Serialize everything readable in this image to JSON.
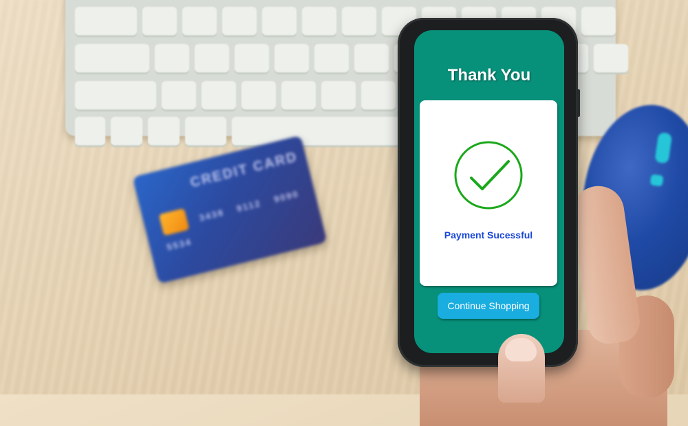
{
  "scene": {
    "background_objects": {
      "keyboard": "white-keyboard",
      "card_label": "CREDIT CARD",
      "card_number_fragments": [
        "5534",
        "3438",
        "9112",
        "9090"
      ],
      "mouse": "blue-mouse"
    }
  },
  "phone_screen": {
    "title": "Thank You",
    "status_icon": "check-circle-icon",
    "status_text": "Payment Sucessful",
    "continue_button_label": "Continue Shopping"
  },
  "colors": {
    "screen_background": "#07917a",
    "panel_background": "#ffffff",
    "check_green": "#1aa81a",
    "status_text_blue": "#1847d8",
    "button_blue": "#19ade0",
    "title_white": "#ffffff"
  }
}
